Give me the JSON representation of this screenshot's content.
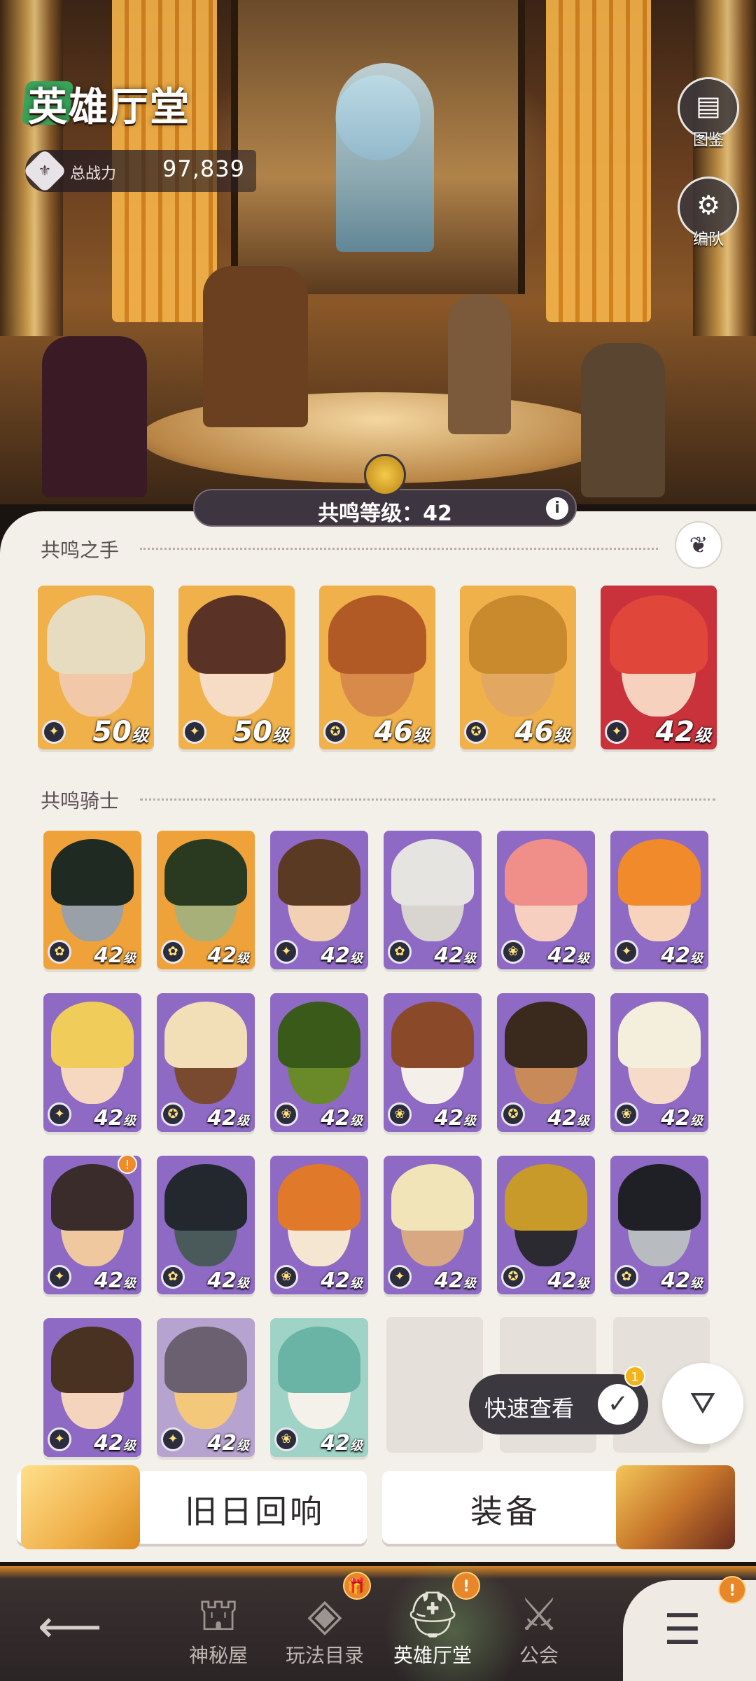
{
  "header": {
    "title": "英雄厅堂",
    "power_label": "总战力",
    "power_value": "97,839",
    "side_buttons": [
      {
        "label": "图鉴",
        "icon": "book-icon"
      },
      {
        "label": "编队",
        "icon": "team-gear-icon"
      }
    ]
  },
  "resonance": {
    "level_text": "共鸣等级：42",
    "info_icon": "i"
  },
  "sections": {
    "hands_title": "共鸣之手",
    "knights_title": "共鸣骑士"
  },
  "level_suffix": "级",
  "hands": [
    {
      "level": "50",
      "faction_icon": "✦",
      "skin": "#f2c9a8",
      "hair": "#e8dcc0",
      "bg": "#f0b04a"
    },
    {
      "level": "50",
      "faction_icon": "✦",
      "skin": "#f6dcc4",
      "hair": "#5a3326",
      "bg": "#f0b04a"
    },
    {
      "level": "46",
      "faction_icon": "✪",
      "skin": "#d88a4a",
      "hair": "#b25a26",
      "bg": "#f0b04a"
    },
    {
      "level": "46",
      "faction_icon": "✪",
      "skin": "#e2a862",
      "hair": "#c98a2e",
      "bg": "#f0b04a"
    },
    {
      "level": "42",
      "faction_icon": "✦",
      "skin": "#f6d2be",
      "hair": "#e0463a",
      "bg": "#c9323a"
    }
  ],
  "knights": [
    {
      "level": "42",
      "faction_icon": "✿",
      "skin": "#9aa0a8",
      "hair": "#1e2a22",
      "bg": "#f0a23a"
    },
    {
      "level": "42",
      "faction_icon": "✿",
      "skin": "#a8b07a",
      "hair": "#2a3a20",
      "bg": "#f0a23a"
    },
    {
      "level": "42",
      "faction_icon": "✦",
      "skin": "#f2d0b4",
      "hair": "#5a3a22",
      "bg": "#8e6ac4"
    },
    {
      "level": "42",
      "faction_icon": "✿",
      "skin": "#d8d4d0",
      "hair": "#e6e4e0",
      "bg": "#8e6ac4"
    },
    {
      "level": "42",
      "faction_icon": "❀",
      "skin": "#f6cfc0",
      "hair": "#f08f8a",
      "bg": "#8e6ac4"
    },
    {
      "level": "42",
      "faction_icon": "✦",
      "skin": "#f6d3ba",
      "hair": "#f08a2a",
      "bg": "#8e6ac4"
    },
    {
      "level": "42",
      "faction_icon": "✦",
      "skin": "#f6d8c0",
      "hair": "#f0cc5a",
      "bg": "#8e6ac4"
    },
    {
      "level": "42",
      "faction_icon": "✪",
      "skin": "#7a4a30",
      "hair": "#f2dfb8",
      "bg": "#8e6ac4"
    },
    {
      "level": "42",
      "faction_icon": "❀",
      "skin": "#6a8a2a",
      "hair": "#3a5a1a",
      "bg": "#8e6ac4"
    },
    {
      "level": "42",
      "faction_icon": "❀",
      "skin": "#f4efe8",
      "hair": "#8a4a2a",
      "bg": "#8e6ac4"
    },
    {
      "level": "42",
      "faction_icon": "✪",
      "skin": "#c98a5a",
      "hair": "#3a2a1e",
      "bg": "#8e6ac4"
    },
    {
      "level": "42",
      "faction_icon": "❀",
      "skin": "#f6dcc8",
      "hair": "#f4eedc",
      "bg": "#8e6ac4"
    },
    {
      "level": "42",
      "faction_icon": "✦",
      "skin": "#f0c8a0",
      "hair": "#3a2c2a",
      "bg": "#8e6ac4",
      "badge": "!"
    },
    {
      "level": "42",
      "faction_icon": "✿",
      "skin": "#4a5a5a",
      "hair": "#22282e",
      "bg": "#8e6ac4"
    },
    {
      "level": "42",
      "faction_icon": "❀",
      "skin": "#f4e6d0",
      "hair": "#e07a2a",
      "bg": "#8e6ac4"
    },
    {
      "level": "42",
      "faction_icon": "✦",
      "skin": "#d8a882",
      "hair": "#f0e4b8",
      "bg": "#8e6ac4"
    },
    {
      "level": "42",
      "faction_icon": "✪",
      "skin": "#2a2a30",
      "hair": "#c89a2a",
      "bg": "#8e6ac4"
    },
    {
      "level": "42",
      "faction_icon": "✿",
      "skin": "#b8bcc0",
      "hair": "#1e2026",
      "bg": "#8e6ac4"
    },
    {
      "level": "42",
      "faction_icon": "✦",
      "skin": "#f4d4bc",
      "hair": "#4a3222",
      "bg": "#8e6ac4"
    },
    {
      "level": "42",
      "faction_icon": "✦",
      "skin": "#f4c87a",
      "hair": "#6a6070",
      "bg": "#b7a3cf"
    },
    {
      "level": "42",
      "faction_icon": "❀",
      "skin": "#f4f0ea",
      "hair": "#6ab4a6",
      "bg": "#9fd3c6"
    }
  ],
  "quick_view": {
    "label": "快速查看",
    "badge": "1"
  },
  "filter_icon": "filter-icon",
  "big_buttons": [
    {
      "label": "旧日回响",
      "accent": "#f0b04a"
    },
    {
      "label": "装备",
      "accent": "#8a3a2a"
    }
  ],
  "nav": {
    "items": [
      {
        "label": "神秘屋",
        "icon": "⛫",
        "badge": ""
      },
      {
        "label": "玩法目录",
        "icon": "◈",
        "badge": "🎁"
      },
      {
        "label": "英雄厅堂",
        "icon": "⛑",
        "badge": "!",
        "active": true
      },
      {
        "label": "公会",
        "icon": "⚔",
        "badge": ""
      }
    ],
    "menu_badge": "!"
  }
}
